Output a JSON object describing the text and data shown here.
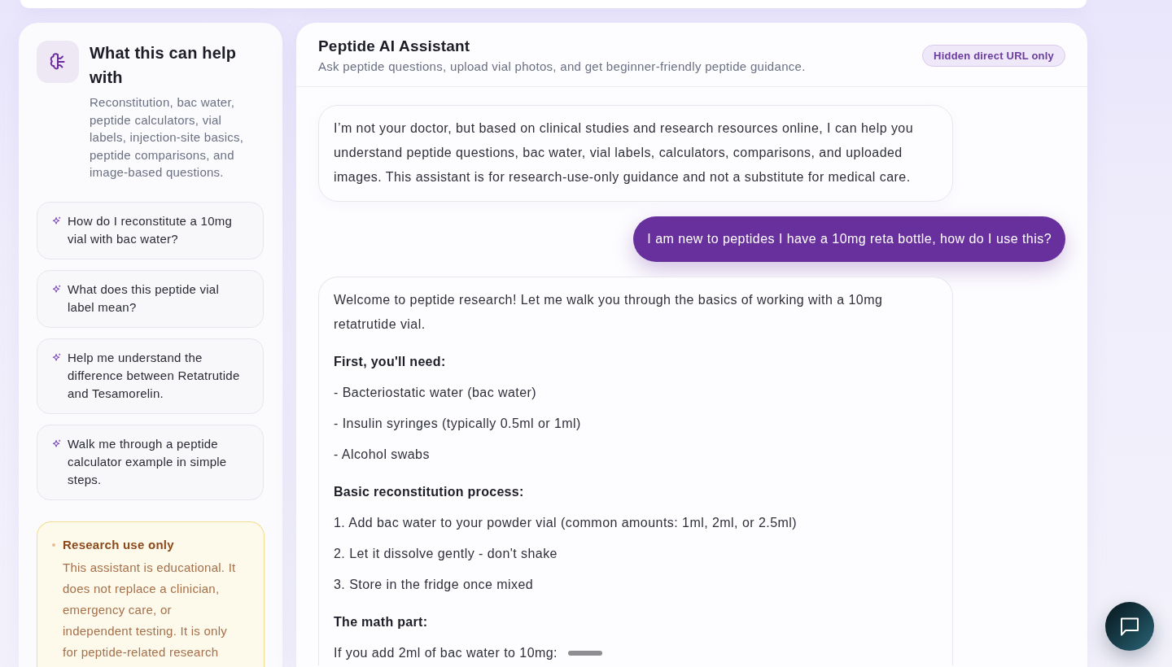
{
  "sidebar": {
    "title": "What this can help with",
    "description": "Reconstitution, bac water, peptide calculators, vial labels, injection-site basics, peptide comparisons, and image-based questions.",
    "suggestions": [
      "How do I reconstitute a 10mg vial with bac water?",
      "What does this peptide vial label mean?",
      "Help me understand the difference between Retatrutide and Tesamorelin.",
      "Walk me through a peptide calculator example in simple steps."
    ],
    "notice": {
      "title": "Research use only",
      "text": "This assistant is educational. It does not replace a clinician, emergency care, or independent testing. It is only for peptide-related research"
    }
  },
  "chat": {
    "title": "Peptide AI Assistant",
    "subtitle": "Ask peptide questions, upload vial photos, and get beginner-friendly peptide guidance.",
    "badge": "Hidden direct URL only",
    "messages": [
      {
        "kind": "assistant",
        "blocks": [
          {
            "kind": "paragraph",
            "text": "I’m not your doctor, but based on clinical studies and research resources online, I can help you understand peptide questions, bac water, vial labels, calculators, comparisons, and uploaded images. This assistant is for research-use-only guidance and not a substitute for medical care."
          }
        ]
      },
      {
        "kind": "user",
        "text": "I am new to peptides I have a 10mg reta bottle, how do I use this?"
      },
      {
        "kind": "assistant",
        "blocks": [
          {
            "kind": "paragraph",
            "text": "Welcome to peptide research! Let me walk you through the basics of working with a 10mg retatrutide vial."
          },
          {
            "kind": "heading",
            "text": "First, you'll need:"
          },
          {
            "kind": "paragraph",
            "text": "- Bacteriostatic water (bac water)"
          },
          {
            "kind": "paragraph",
            "text": "- Insulin syringes (typically 0.5ml or 1ml)"
          },
          {
            "kind": "paragraph",
            "text": "- Alcohol swabs"
          },
          {
            "kind": "heading",
            "text": "Basic reconstitution process:"
          },
          {
            "kind": "paragraph",
            "text": "1. Add bac water to your powder vial (common amounts: 1ml, 2ml, or 2.5ml)"
          },
          {
            "kind": "paragraph",
            "text": "2. Let it dissolve gently - don't shake"
          },
          {
            "kind": "paragraph",
            "text": "3. Store in the fridge once mixed"
          },
          {
            "kind": "heading",
            "text": "The math part:"
          },
          {
            "kind": "paragraph",
            "text": "If you add 2ml of bac water to 10mg:"
          }
        ]
      }
    ]
  }
}
